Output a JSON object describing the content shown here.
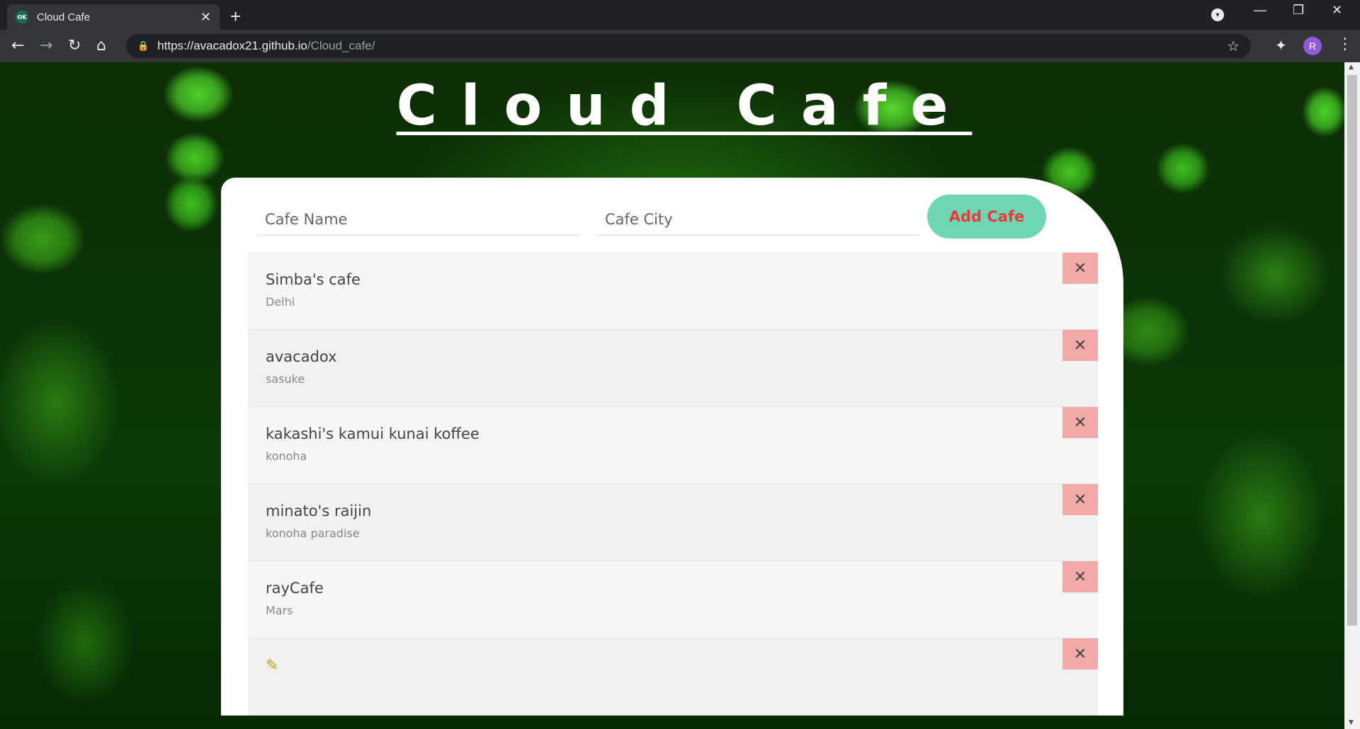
{
  "browser": {
    "tab_title": "Cloud Cafe",
    "favicon_text": "OK",
    "url_host": "https://avacadox21.github.io",
    "url_path": "/Cloud_cafe/",
    "profile_initial": "R"
  },
  "page": {
    "title": "Cloud Cafe"
  },
  "form": {
    "name_placeholder": "Cafe Name",
    "city_placeholder": "Cafe City",
    "add_label": "Add Cafe"
  },
  "cafes": [
    {
      "name": "Simba's cafe",
      "city": "Delhi"
    },
    {
      "name": "avacadox",
      "city": "sasuke"
    },
    {
      "name": "kakashi's kamui kunai koffee",
      "city": "konoha"
    },
    {
      "name": "minato's raijin",
      "city": "konoha paradise"
    },
    {
      "name": "rayCafe",
      "city": "Mars"
    },
    {
      "name": "",
      "city": ""
    }
  ],
  "delete_label": "✕",
  "colors": {
    "add_button_bg": "#6fd6b3",
    "add_button_text": "#e8393b",
    "delete_button_bg": "#f4a9a9"
  }
}
